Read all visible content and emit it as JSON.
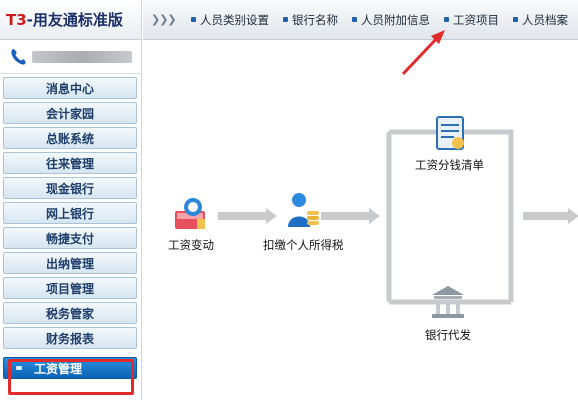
{
  "app": {
    "logo_prefix": "T3",
    "logo_name": "-用友通标准版"
  },
  "sidebar": {
    "items": [
      {
        "label": "消息中心"
      },
      {
        "label": "会计家园"
      },
      {
        "label": "总账系统"
      },
      {
        "label": "往来管理"
      },
      {
        "label": "现金银行"
      },
      {
        "label": "网上银行"
      },
      {
        "label": "畅捷支付"
      },
      {
        "label": "出纳管理"
      },
      {
        "label": "项目管理"
      },
      {
        "label": "税务管家"
      },
      {
        "label": "财务报表"
      },
      {
        "label": "工资管理"
      }
    ],
    "active_index": 11
  },
  "topbar": {
    "collapse_icon": "double-chevron-right-icon",
    "tabs": [
      {
        "label": "人员类别设置"
      },
      {
        "label": "银行名称"
      },
      {
        "label": "人员附加信息"
      },
      {
        "label": "工资项目"
      },
      {
        "label": "人员档案"
      }
    ]
  },
  "workflow": {
    "nodes": [
      {
        "label": "工资变动",
        "icon": "salary-change-icon"
      },
      {
        "label": "扣缴个人所得税",
        "icon": "income-tax-icon"
      },
      {
        "label": "工资分钱清单",
        "icon": "salary-list-icon"
      },
      {
        "label": "银行代发",
        "icon": "bank-payment-icon"
      }
    ]
  },
  "colors": {
    "active_nav": "#0b63b5",
    "annotation_red": "#e12a2a",
    "brand_red": "#cc1b1b",
    "brand_blue": "#1a2f6b"
  }
}
